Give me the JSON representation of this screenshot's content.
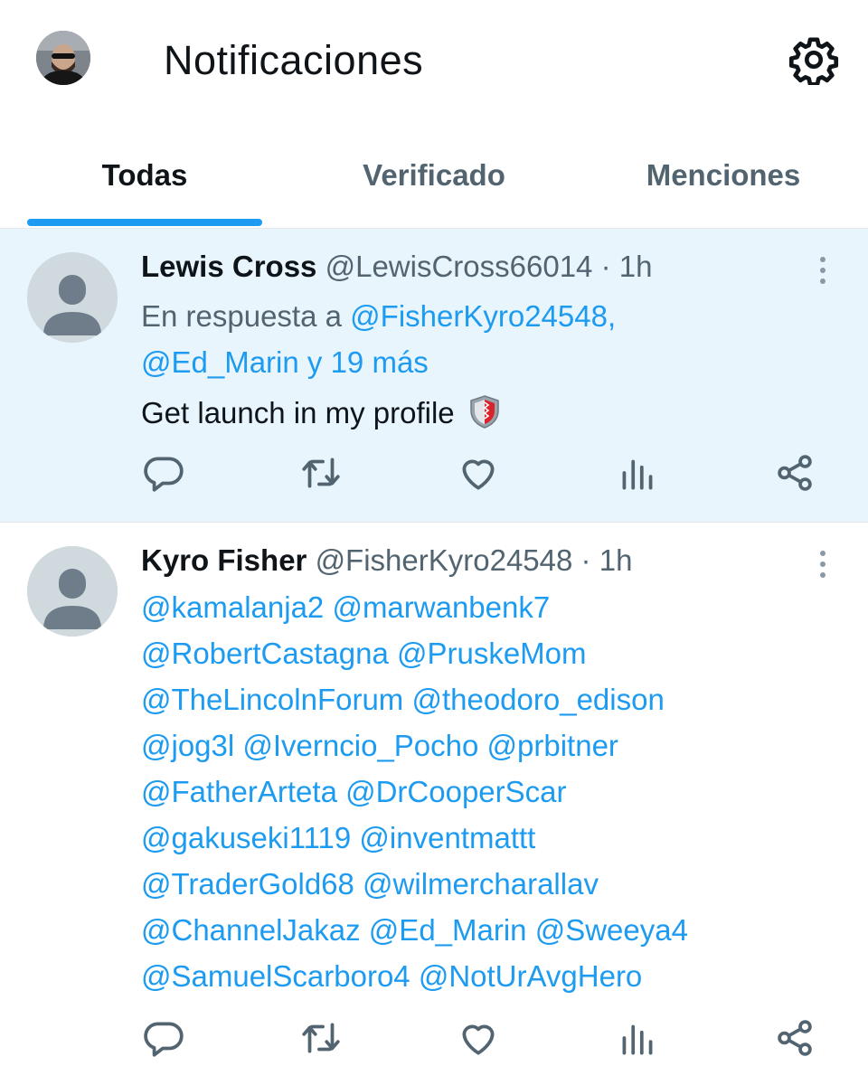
{
  "header": {
    "title": "Notificaciones",
    "avatar_icon": "user-avatar",
    "settings_icon": "gear-icon"
  },
  "tabs": [
    {
      "label": "Todas",
      "active": true
    },
    {
      "label": "Verificado",
      "active": false
    },
    {
      "label": "Menciones",
      "active": false
    }
  ],
  "colors": {
    "accent": "#1d9bf0",
    "secondary_text": "#536471",
    "highlight_bg": "#e8f5fd"
  },
  "notifications": [
    {
      "name": "Lewis Cross",
      "handle": "@LewisCross66014",
      "separator": "·",
      "time": "1h",
      "reply_prefix": "En respuesta a ",
      "reply_user": "@FisherKyro24548,",
      "reply_user2": "@Ed_Marin",
      "reply_and": " y ",
      "reply_more": "19 más",
      "body": "Get launch in my profile",
      "body_emoji": "shield-emoji"
    },
    {
      "name": "Kyro Fisher",
      "handle": "@FisherKyro24548",
      "separator": "·",
      "time": "1h",
      "mention_lines": [
        "@kamalanja2 @marwanbenk7",
        "@RobertCastagna @PruskeMom",
        "@TheLincolnForum @theodoro_edison",
        "@jog3l @Iverncio_Pocho @prbitner",
        "@FatherArteta @DrCooperScar",
        "@gakuseki1119 @inventmattt",
        "@TraderGold68 @wilmercharallav",
        "@ChannelJakaz @Ed_Marin @Sweeya4",
        "@SamuelScarboro4 @NotUrAvgHero"
      ]
    }
  ],
  "action_icons": [
    "reply-icon",
    "retweet-icon",
    "like-icon",
    "views-icon",
    "share-icon"
  ]
}
